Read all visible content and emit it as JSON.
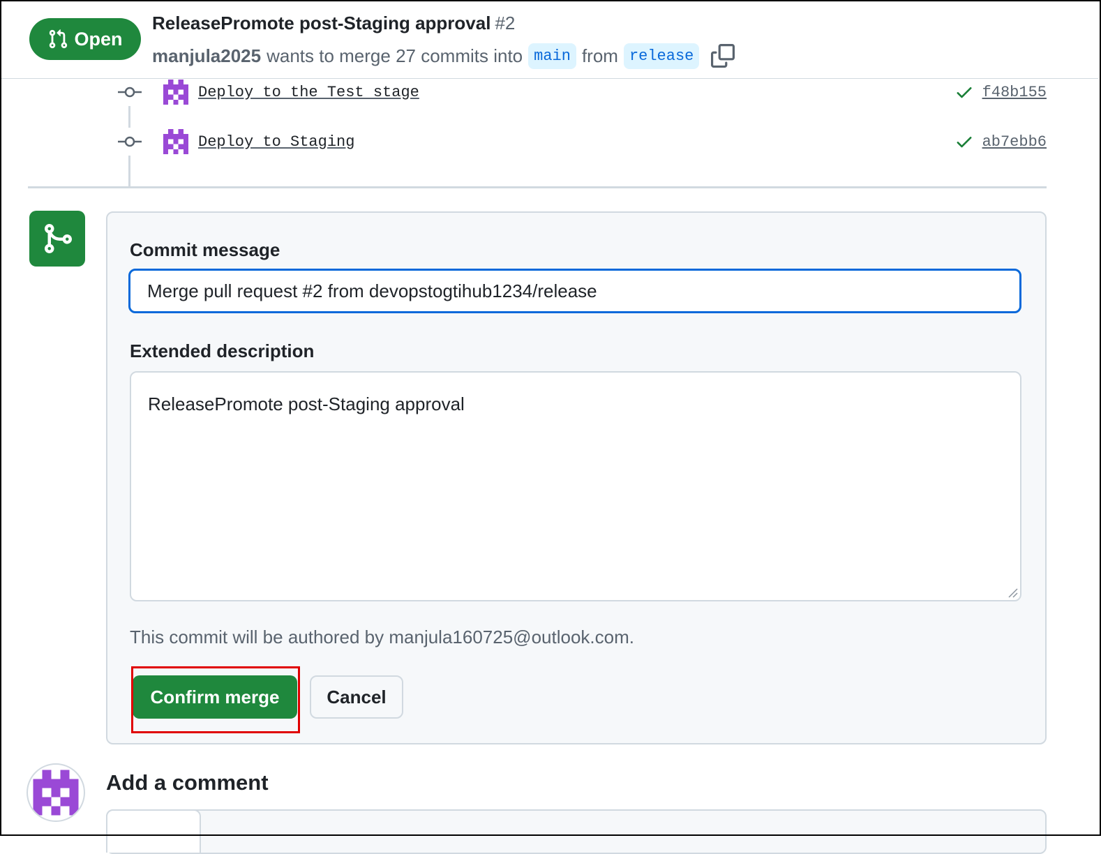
{
  "header": {
    "state_label": "Open",
    "title": "ReleasePromote post-Staging approval",
    "number": "#2",
    "author": "manjula2025",
    "merge_text": "wants to merge 27 commits into",
    "base_branch": "main",
    "from_text": "from",
    "head_branch": "release"
  },
  "commits": [
    {
      "message": "Deploy to the Test stage",
      "sha": "f48b155"
    },
    {
      "message": "Deploy to Staging",
      "sha": "ab7ebb6"
    }
  ],
  "merge_form": {
    "commit_message_label": "Commit message",
    "commit_message_value": "Merge pull request #2 from devopstogtihub1234/release",
    "extended_description_label": "Extended description",
    "extended_description_value": "ReleasePromote post-Staging approval",
    "author_note": "This commit will be authored by manjula160725@outlook.com.",
    "confirm_label": "Confirm merge",
    "cancel_label": "Cancel"
  },
  "comment": {
    "heading": "Add a comment"
  },
  "colors": {
    "success": "#1f883d",
    "accent": "#0969da",
    "highlight": "#e00000",
    "avatar": "#9a49d6"
  }
}
